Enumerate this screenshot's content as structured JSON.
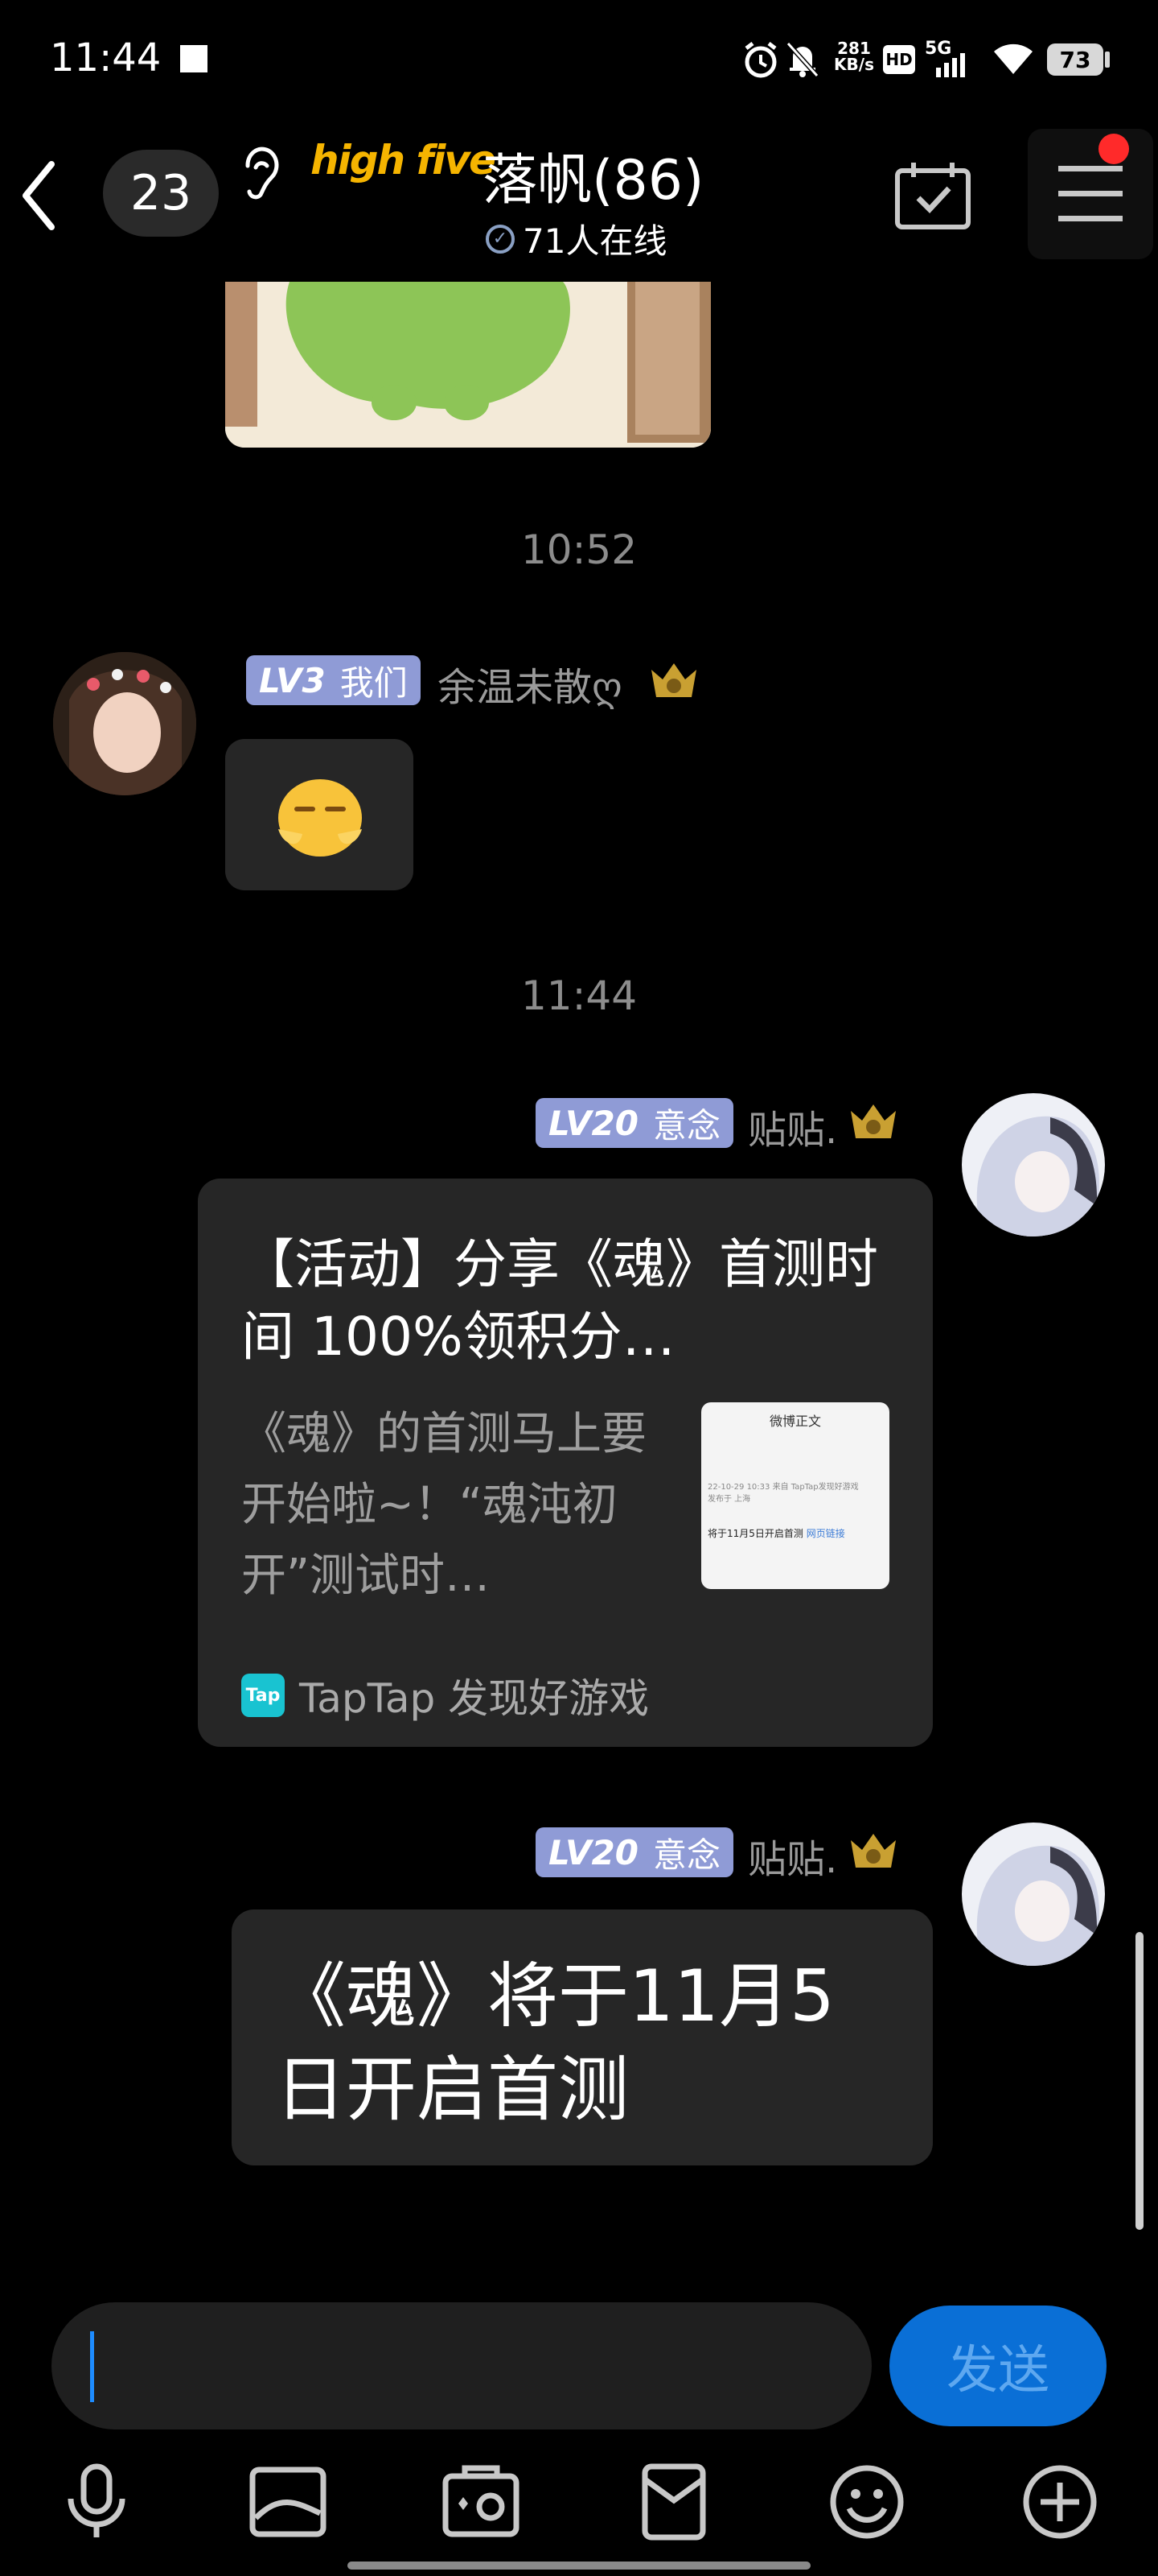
{
  "status_bar": {
    "time": "11:44",
    "net_speed_value": "281",
    "net_speed_unit": "KB/s",
    "hd": "HD",
    "network": "5G",
    "battery": "73"
  },
  "header": {
    "back_icon": "chevron-left-icon",
    "unread_count": "23",
    "ear_icon": "ear-icon",
    "logo_text": "high five",
    "group_name": "落帆(86)",
    "online_text": "71人在线",
    "calendar_icon": "calendar-check-icon",
    "menu_icon": "menu-icon"
  },
  "messages": {
    "ts1": "10:52",
    "ts2": "11:44",
    "m1": {
      "level": "LV3",
      "title": "我们",
      "nickname": "余温未散ღ"
    },
    "m2": {
      "level": "LV20",
      "title": "意念",
      "nickname": "贴贴.",
      "card_title": "【活动】分享《魂》首测时间 100%领积分…",
      "card_desc": "《魂》的首测马上要开始啦~！“魂沌初开”测试时…",
      "thumb_header": "微博正文",
      "thumb_meta_1": "22-10-29 10:33  来自 TapTap发现好游戏",
      "thumb_meta_2": "发布于 上海",
      "thumb_body": "将于11月5日开启首测",
      "thumb_link": "网页链接",
      "source_icon": "Tap",
      "source": "TapTap 发现好游戏"
    },
    "m3": {
      "level": "LV20",
      "title": "意念",
      "nickname": "贴贴.",
      "text": "《魂》将于11月5日开启首测"
    }
  },
  "input_bar": {
    "placeholder": "",
    "send_label": "发送"
  },
  "toolbar_icons": [
    "microphone-icon",
    "image-icon",
    "camera-icon",
    "red-packet-icon",
    "emoji-icon",
    "plus-icon"
  ],
  "colors": {
    "background": "#000000",
    "bubble": "#262626",
    "level_badge": "#8f9bd6",
    "send_button": "#0a6fd6",
    "logo": "#f5b400",
    "menu_dot": "#ff2a2a"
  }
}
